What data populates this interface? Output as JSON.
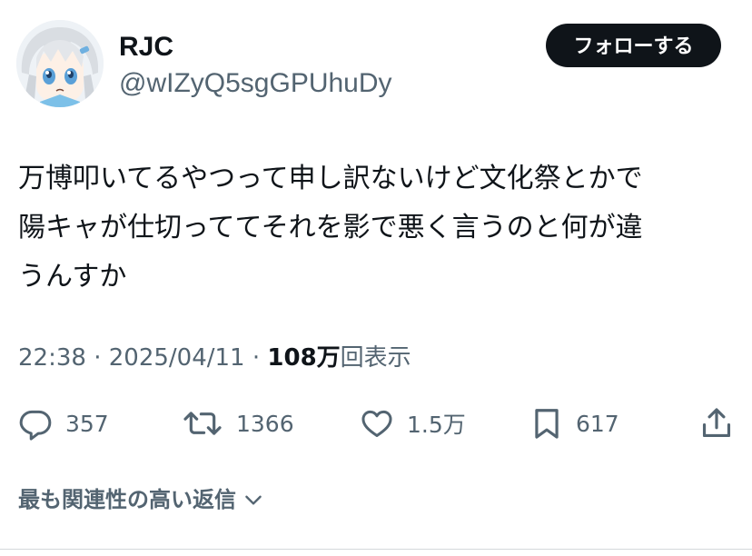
{
  "author": {
    "display_name": "RJC",
    "handle": "@wIZyQ5sgGPUhuDy",
    "follow_label": "フォローする"
  },
  "tweet": {
    "lines": [
      "万博叩いてるやつって申し訳ないけど文化祭とかで",
      "陽キャが仕切っててそれを影で悪く言うのと何が違",
      "うんすか"
    ],
    "time": "22:38",
    "separator": "·",
    "date": "2025/04/11",
    "views_count": "108万",
    "views_label": "回表示"
  },
  "actions": {
    "replies": "357",
    "reposts": "1366",
    "likes": "1.5万",
    "bookmarks": "617"
  },
  "related_label": "最も関連性の高い返信",
  "colors": {
    "text_primary": "#0f1419",
    "text_secondary": "#536471",
    "follow_bg": "#0f1419",
    "follow_text": "#ffffff"
  },
  "icons": {
    "reply": "reply-icon",
    "repost": "repost-icon",
    "like": "like-icon",
    "bookmark": "bookmark-icon",
    "share": "share-icon",
    "dropdown": "chevron-down-icon"
  }
}
